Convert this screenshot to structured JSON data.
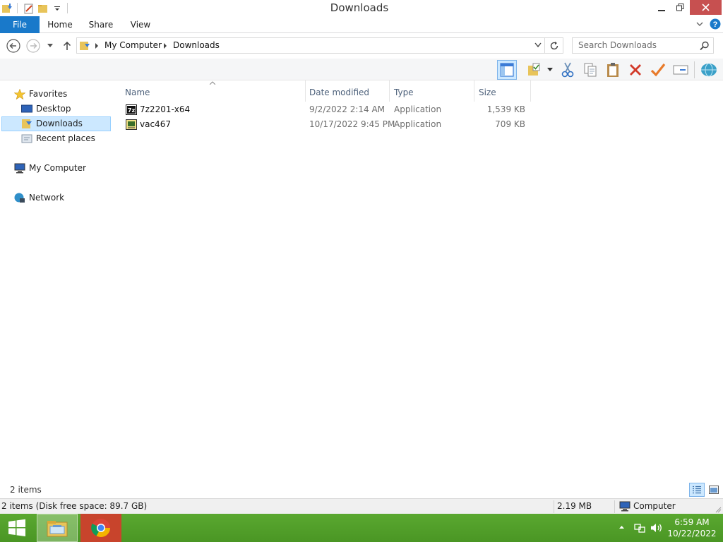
{
  "window": {
    "title": "Downloads"
  },
  "ribbon": {
    "tabs": [
      "File",
      "Home",
      "Share",
      "View"
    ]
  },
  "address": {
    "crumbs": [
      "My Computer",
      "Downloads"
    ],
    "search_placeholder": "Search Downloads"
  },
  "navpane": {
    "favorites": "Favorites",
    "desktop": "Desktop",
    "downloads": "Downloads",
    "recent": "Recent places",
    "computer": "My Computer",
    "network": "Network"
  },
  "filelist": {
    "columns": [
      "Name",
      "Date modified",
      "Type",
      "Size"
    ],
    "rows": [
      {
        "name": "7z2201-x64",
        "date": "9/2/2022 2:14 AM",
        "type": "Application",
        "size": "1,539 KB"
      },
      {
        "name": "vac467",
        "date": "10/17/2022 9:45 PM",
        "type": "Application",
        "size": "709 KB"
      }
    ]
  },
  "status": {
    "item_count": "2 items",
    "disk_info": "2 items (Disk free space: 89.7 GB)",
    "size": "2.19 MB",
    "location": "Computer"
  },
  "taskbar": {
    "time": "6:59 AM",
    "date": "10/22/2022"
  },
  "colors": {
    "file_tab": "#1979ca",
    "selection": "#cce8ff",
    "taskbar": "#4e9a28",
    "close_button": "#c75050"
  }
}
